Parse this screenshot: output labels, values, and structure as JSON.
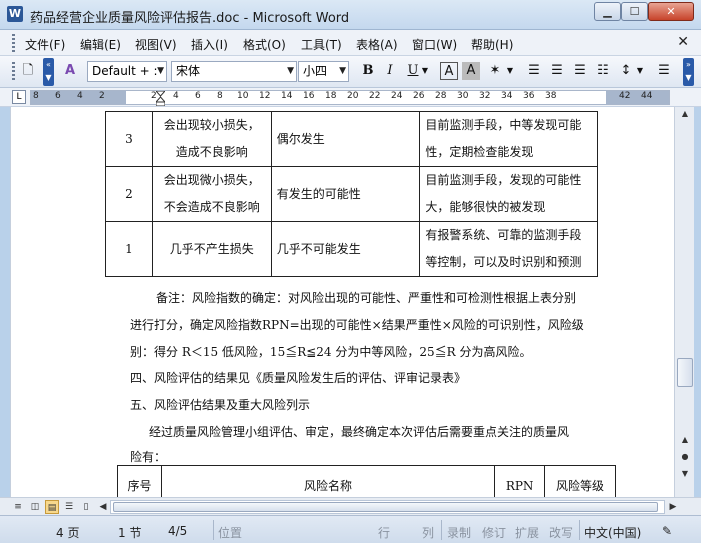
{
  "window": {
    "title": "药品经营企业质量风险评估报告.doc - Microsoft Word",
    "icon": "W",
    "min_label": "▁",
    "max_label": "☐",
    "close_label": "✕"
  },
  "menu": {
    "items": [
      "文件(F)",
      "编辑(E)",
      "视图(V)",
      "插入(I)",
      "格式(O)",
      "工具(T)",
      "表格(A)",
      "窗口(W)",
      "帮助(H)"
    ],
    "close_doc": "✕"
  },
  "toolbar": {
    "style": "Default + :",
    "font": "宋体",
    "size": "小四",
    "bold": "B",
    "italic": "I",
    "underline": "U"
  },
  "ruler": {
    "corner": "L",
    "numbers": [
      "8",
      "6",
      "4",
      "2",
      "2",
      "4",
      "6",
      "8",
      "10",
      "12",
      "14",
      "16",
      "18",
      "20",
      "22",
      "24",
      "26",
      "28",
      "30",
      "32",
      "34",
      "36",
      "38",
      "42",
      "44"
    ]
  },
  "document": {
    "table_rows": [
      {
        "score": "3",
        "severity": [
          "会出现较小损失，",
          "造成不良影响"
        ],
        "likelihood": "偶尔发生",
        "detect": [
          "目前监测手段，中等发现可能",
          "性，定期检查能发现"
        ]
      },
      {
        "score": "2",
        "severity": [
          "会出现微小损失，",
          "不会造成不良影响"
        ],
        "likelihood": "有发生的可能性",
        "detect": [
          "目前监测手段，发现的可能性",
          "大，能够很快的被发现"
        ]
      },
      {
        "score": "1",
        "severity": [
          "几乎不产生损失"
        ],
        "likelihood": "几乎不可能发生",
        "detect": [
          "有报警系统、可靠的监测手段",
          "等控制，可以及时识别和预测"
        ]
      }
    ],
    "para_note_1": "备注：风险指数的确定：对风险出现的可能性、严重性和可检测性根据上表分别",
    "para_note_2": "进行打分，确定风险指数RPN=出现的可能性×结果严重性×风险的可识别性，风险级",
    "para_note_3": "别：得分 R＜15 低风险，15≦R≦24 分为中等风险，25≦R 分为高风险。",
    "heading_4": "四、风险评估的结果见《质量风险发生后的评估、评审记录表》",
    "heading_5": "五、风险评估结果及重大风险列示",
    "para_assess_1": "经过质量风险管理小组评估、审定，最终确定本次评估后需要重点关注的质量风",
    "para_assess_2": "险有：",
    "table2_headers": [
      "序号",
      "风险名称",
      "RPN",
      "风险等级"
    ]
  },
  "status": {
    "page": "4 页",
    "section": "1 节",
    "page_of": "4/5",
    "position": "位置",
    "line": "行",
    "column": "列",
    "rec": "录制",
    "trk": "修订",
    "ext": "扩展",
    "ovr": "改写",
    "language": "中文(中国)"
  },
  "colors": {
    "title_bar": "#c4d8ee",
    "accent": "#2a5aa8",
    "close_button": "#c7432a"
  }
}
